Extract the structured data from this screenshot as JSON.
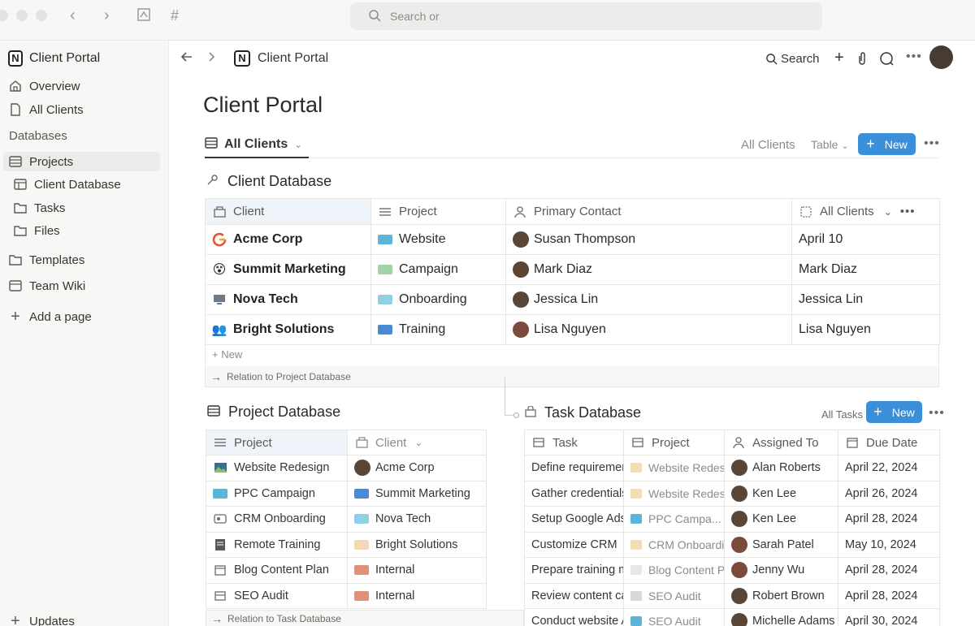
{
  "topbar": {
    "search_placeholder": "Search or"
  },
  "sidebar": {
    "workspace": "Client Portal",
    "items_top": [
      {
        "label": "Overview",
        "icon": "home-icon"
      },
      {
        "label": "All Clients",
        "icon": "page-icon"
      }
    ],
    "databases_heading": "Databases",
    "db_items": [
      {
        "label": "Projects",
        "icon": "database-icon"
      },
      {
        "label": "Client Database",
        "icon": "database-icon"
      },
      {
        "label": "Tasks",
        "icon": "folder-icon"
      },
      {
        "label": "Files",
        "icon": "folder-icon"
      }
    ],
    "templates": "Templates",
    "team_wiki": "Team Wiki",
    "add_page": "Add a page",
    "updates": "Updates"
  },
  "header": {
    "breadcrumb": "Client Portal",
    "search_label": "Search"
  },
  "page": {
    "title": "Client Portal",
    "view_tab": "All Clients",
    "view_all": "All Clients",
    "view_type": "Table",
    "new_label": "New"
  },
  "client_db": {
    "title": "Client Database",
    "columns": [
      "Client",
      "Project",
      "Primary Contact",
      "All Clients"
    ],
    "rows": [
      {
        "client": "Acme Corp",
        "project": "Website",
        "contact": "Susan Thompson",
        "extra": "April 10"
      },
      {
        "client": "Summit Marketing",
        "project": "Campaign",
        "contact": "Mark Diaz",
        "extra": "Mark Diaz"
      },
      {
        "client": "Nova Tech",
        "project": "Onboarding",
        "contact": "Jessica Lin",
        "extra": "Jessica Lin"
      },
      {
        "client": "Bright Solutions",
        "project": "Training",
        "contact": "Lisa Nguyen",
        "extra": "Lisa Nguyen"
      }
    ],
    "new_row": "+ New",
    "relation": "Relation to Project Database"
  },
  "project_db": {
    "title": "Project Database",
    "columns": [
      "Project",
      "Client"
    ],
    "rows": [
      {
        "project": "Website Redesign",
        "client": "Acme Corp"
      },
      {
        "project": "PPC Campaign",
        "client": "Summit Marketing"
      },
      {
        "project": "CRM Onboarding",
        "client": "Nova Tech"
      },
      {
        "project": "Remote Training",
        "client": "Bright Solutions"
      },
      {
        "project": "Blog Content Plan",
        "client": "Internal"
      },
      {
        "project": "SEO Audit",
        "client": "Internal"
      }
    ],
    "relation": "Relation to Task Database"
  },
  "task_db": {
    "title": "Task Database",
    "view_label": "All Tasks",
    "new_label": "New",
    "columns": [
      "Task",
      "Project",
      "Assigned To",
      "Due Date"
    ],
    "rows": [
      {
        "task": "Define requiremer",
        "project": "Website Redes",
        "assignee": "Alan Roberts",
        "due": "April 22, 2024"
      },
      {
        "task": "Gather credentials",
        "project": "Website Redes",
        "assignee": "Ken Lee",
        "due": "April 26, 2024"
      },
      {
        "task": "Setup Google Ads",
        "project": "PPC Campa...",
        "assignee": "Ken Lee",
        "due": "April 28, 2024"
      },
      {
        "task": "Customize CRM",
        "project": "CRM Onboardi",
        "assignee": "Sarah Patel",
        "due": "May 10, 2024"
      },
      {
        "task": "Prepare training m",
        "project": "Blog Content Pl",
        "assignee": "Jenny Wu",
        "due": "April 28, 2024"
      },
      {
        "task": "Review content ca",
        "project": "SEO Audit",
        "assignee": "Robert Brown",
        "due": "April 28, 2024"
      },
      {
        "task": "Conduct website A",
        "project": "SEO Audit",
        "assignee": "Michelle Adams",
        "due": "April 30, 2024"
      }
    ]
  }
}
